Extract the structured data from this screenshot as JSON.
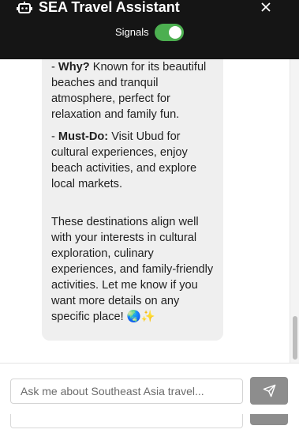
{
  "header": {
    "title": "SEA Travel Assistant",
    "signals_label": "Signals",
    "signals_on": true,
    "icons": {
      "bot": "robot-icon",
      "close": "close-icon"
    },
    "background": "#151515",
    "toggle_color": "#4caf50"
  },
  "message": {
    "why_label": "Why?",
    "why_text": " Known for its beautiful beaches and tranquil atmosphere, perfect for relaxation and family fun.",
    "mustdo_label": "Must-Do:",
    "mustdo_text": " Visit Ubud for cultural experiences, enjoy beach activities, and explore local markets.",
    "closing": "These destinations align well with your interests in cultural exploration, culinary experiences, and family-friendly activities. Let me know if you want more details on any specific place! 🌏✨"
  },
  "input": {
    "placeholder": "Ask me about Southeast Asia travel...",
    "value": ""
  },
  "send_button": {
    "icon": "send-icon",
    "color": "#8d8d8d"
  }
}
